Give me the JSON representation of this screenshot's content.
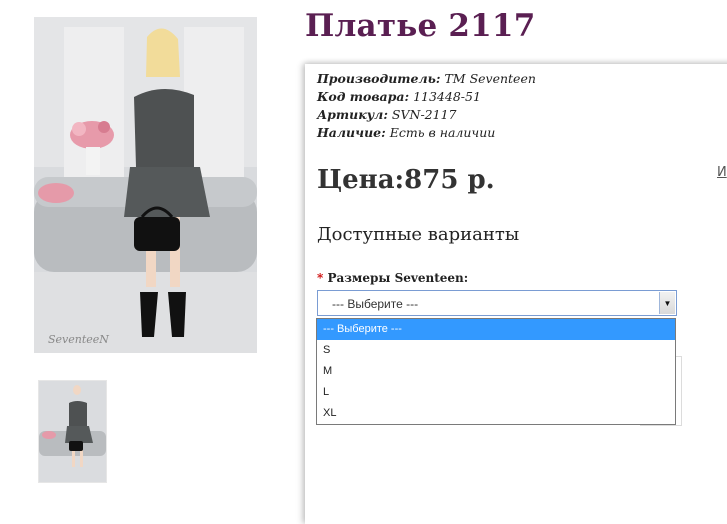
{
  "product": {
    "title": "Платье 2117",
    "manufacturer_label": "Производитель:",
    "manufacturer_value": "ТМ Seventeen",
    "code_label": "Код товара:",
    "code_value": "113448-51",
    "sku_label": "Артикул:",
    "sku_value": "SVN-2117",
    "availability_label": "Наличие:",
    "availability_value": "Есть в наличии",
    "price": "Цена:875 р.",
    "side_link": "И"
  },
  "variants": {
    "title": "Доступные варианты",
    "required_mark": "*",
    "size_label": "Размеры Seventeen:",
    "selected": "--- Выберите ---",
    "options": [
      "--- Выберите ---",
      "S",
      "M",
      "L",
      "XL"
    ]
  },
  "images": {
    "watermark": "SeventeeN"
  },
  "colors": {
    "title": "#5a1f52",
    "highlight": "#3399ff",
    "required": "#cc0000"
  }
}
